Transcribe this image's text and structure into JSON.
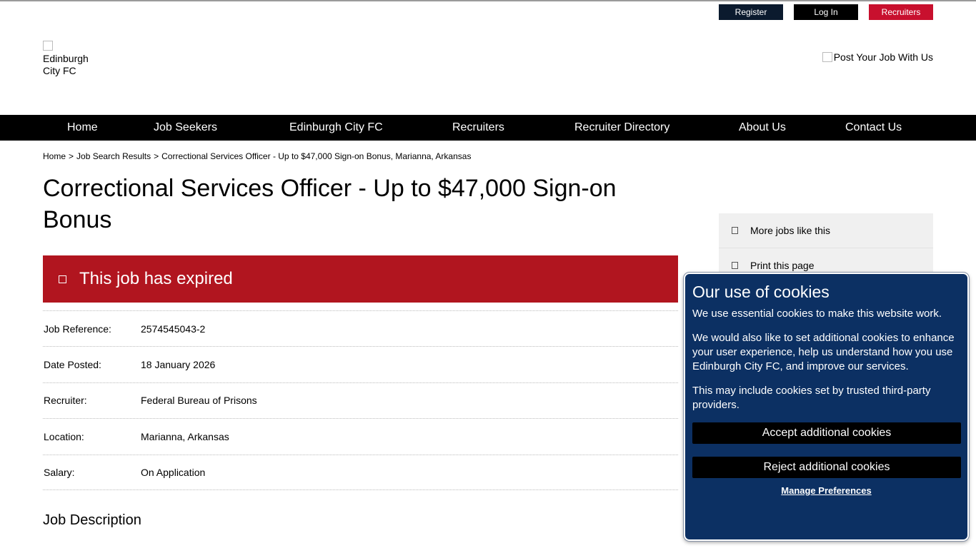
{
  "header": {
    "register_label": "Register",
    "login_label": "Log In",
    "recruiters_label": "Recruiters",
    "logo_alt": "Edinburgh City FC",
    "post_job_label": "Post Your Job With Us"
  },
  "nav": {
    "items": [
      {
        "label": "Home"
      },
      {
        "label": "Job Seekers"
      },
      {
        "label": "Edinburgh City FC"
      },
      {
        "label": "Recruiters"
      },
      {
        "label": "Recruiter Directory"
      },
      {
        "label": "About Us"
      },
      {
        "label": "Contact Us"
      }
    ]
  },
  "breadcrumb": {
    "items": [
      "Home",
      "Job Search Results",
      "Correctional Services Officer - Up to $47,000 Sign-on Bonus, Marianna, Arkansas"
    ],
    "separator": ">"
  },
  "job": {
    "title": "Correctional Services Officer - Up to $47,000 Sign-on Bonus",
    "expired_message": "This job has expired",
    "details": [
      {
        "label": "Job Reference:",
        "value": "2574545043-2"
      },
      {
        "label": "Date Posted:",
        "value": "18 January 2026"
      },
      {
        "label": "Recruiter:",
        "value": "Federal Bureau of Prisons"
      },
      {
        "label": "Location:",
        "value": "Marianna, Arkansas"
      },
      {
        "label": "Salary:",
        "value": "On Application"
      }
    ],
    "description_heading": "Job Description"
  },
  "sidebar": {
    "items": [
      {
        "label": "More jobs like this",
        "icon": "search-icon"
      },
      {
        "label": "Print this page",
        "icon": "print-icon"
      }
    ]
  },
  "cookie_banner": {
    "title": "Our use of cookies",
    "paragraph1": "We use essential cookies to make this website work.",
    "paragraph2": "We would also like to set additional cookies to enhance your user experience, help us understand how you use Edinburgh City FC, and improve our services.",
    "paragraph3": "This may include cookies set by trusted third-party providers.",
    "accept_label": "Accept additional cookies",
    "reject_label": "Reject additional cookies",
    "manage_label": "Manage Preferences"
  },
  "colors": {
    "nav_background": "#000000",
    "register_button": "#0b1a2e",
    "recruiters_button": "#c8102e",
    "expired_banner": "#b1151f",
    "cookie_background": "#0c3063"
  }
}
